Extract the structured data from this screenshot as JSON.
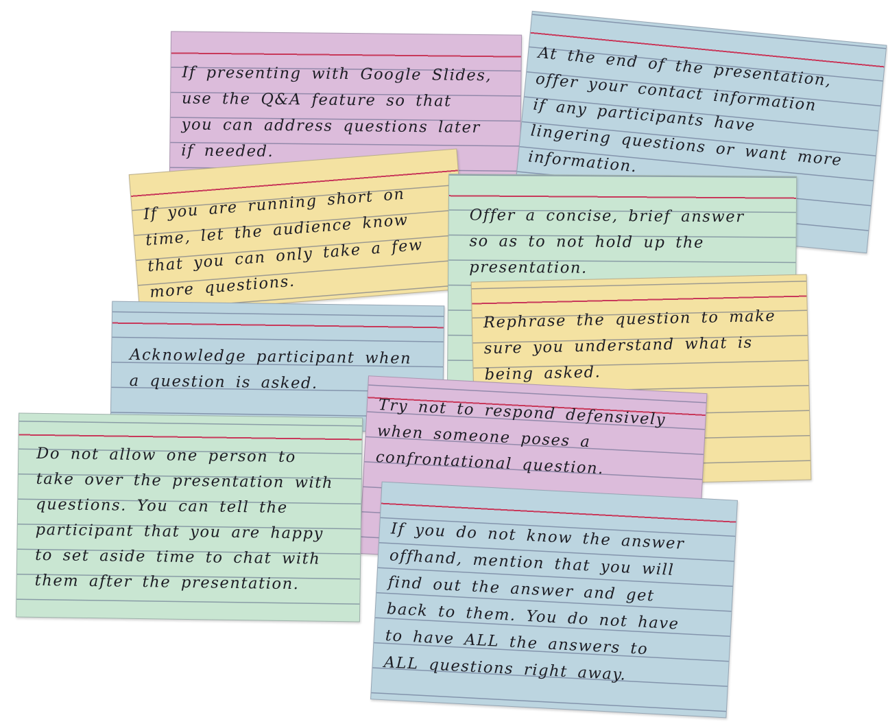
{
  "cards": [
    {
      "color": "pink",
      "hex": "#dcbcdb",
      "text": "If presenting with Google Slides,\nuse the Q&A feature so that\nyou can address questions later\nif needed."
    },
    {
      "color": "blue",
      "hex": "#bcd5e0",
      "text": "At the end of the presentation,\noffer your contact information\nif any participants have\nlingering questions or want more\ninformation."
    },
    {
      "color": "yellow",
      "hex": "#f4e2a2",
      "text": "If you are running short on\ntime, let the audience know\nthat you can only take a few\nmore questions."
    },
    {
      "color": "green",
      "hex": "#c9e6d2",
      "text": "Offer a concise, brief answer\nso as to not hold up the\npresentation."
    },
    {
      "color": "yellow",
      "hex": "#f4e2a2",
      "text": "Rephrase the question to make\nsure you understand what is\nbeing asked."
    },
    {
      "color": "blue",
      "hex": "#bcd5e0",
      "text": "Acknowledge participant when\na question is asked."
    },
    {
      "color": "pink",
      "hex": "#dcbcdb",
      "text": "Try not to respond defensively\nwhen someone poses a\nconfrontational question."
    },
    {
      "color": "green",
      "hex": "#c9e6d2",
      "text": "Do not allow one person to\ntake over the presentation with\nquestions. You can tell the\nparticipant that you are happy\nto set aside time to chat with\nthem after the presentation."
    },
    {
      "color": "blue",
      "hex": "#bcd5e0",
      "text": "If you do not know the answer\noffhand, mention that you will\nfind out the answer and get\nback to them. You do not have\nto have ALL the answers to\nALL questions right away."
    }
  ]
}
